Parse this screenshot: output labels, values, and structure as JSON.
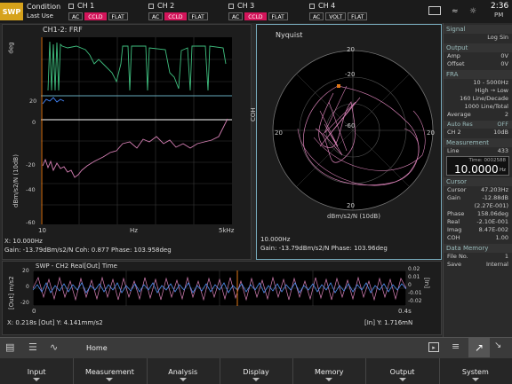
{
  "topbar": {
    "swp": "SWP",
    "condition": "Condition",
    "last_use": "Last Use",
    "channels": [
      {
        "name": "CH 1",
        "tags": [
          "AC",
          "CCLD",
          "FLAT"
        ],
        "active": [
          false,
          true,
          false
        ]
      },
      {
        "name": "CH 2",
        "tags": [
          "AC",
          "CCLD",
          "FLAT"
        ],
        "active": [
          false,
          true,
          false
        ]
      },
      {
        "name": "CH 3",
        "tags": [
          "AC",
          "CCLD",
          "FLAT"
        ],
        "active": [
          false,
          true,
          false
        ]
      },
      {
        "name": "CH 4",
        "tags": [
          "AC",
          "VOLT",
          "FLAT"
        ],
        "active": [
          false,
          false,
          false
        ]
      }
    ],
    "time": "2:36",
    "ampm": "PM"
  },
  "frf": {
    "title": "CH1-2: FRF",
    "ylabel_top": "deg",
    "ylabel_bottom": "dBm/s2/N (10dB)",
    "yticks": [
      "20",
      "0",
      "-20",
      "-40",
      "-60"
    ],
    "xticks": [
      "10",
      "Hz",
      "5kHz"
    ],
    "cursor_x": "X: 10.000Hz",
    "readout": "Gain: -13.79dBm/s2/N Coh: 0.877 Phase: 103.958deg"
  },
  "nyquist": {
    "title": "Nyquist",
    "ylabel": "COH",
    "rings": [
      "20",
      "-20",
      "-60"
    ],
    "sides": [
      "20",
      "20"
    ],
    "bottom": "20",
    "xlabel": "dBm/s2/N (10dB)",
    "cursor": "10.000Hz",
    "readout": "Gain: -13.79dBm/s2/N  Phase: 103.96deg"
  },
  "time": {
    "title": "SWP - CH2 Real[Out] Time",
    "ylabel_left": "[Out] m/s2",
    "ylabel_right": "[In]",
    "left_ticks": [
      "20",
      "0",
      "-20"
    ],
    "right_ticks": [
      "0.02",
      "0.01",
      "0",
      "-0.01",
      "-0.02"
    ],
    "xticks": [
      "0",
      "0.4s"
    ],
    "readout_left": "X: 0.218s [Out] Y: 4.141mm/s2",
    "readout_right": "[In] Y: 1.716mN"
  },
  "side": {
    "signal_h": "Signal",
    "signal": "Log Sin",
    "output_h": "Output",
    "amp_l": "Amp",
    "amp": "0V",
    "offset_l": "Offset",
    "offset": "0V",
    "fra_h": "FRA",
    "fra1": "10 -   5000Hz",
    "fra2": "High → Low",
    "fra3": "160 Line/Decade",
    "fra4": "1000 Line/Total",
    "avg_l": "Average",
    "avg": "2",
    "autores_h": "Auto Res",
    "autores": "OFF",
    "autores_ch": "CH 2",
    "autores_db": "10dB",
    "meas_h": "Measurement",
    "line_l": "Line",
    "line": "433",
    "time_l": "Time: 0002588",
    "big": "10.0000",
    "big_unit": "Hz",
    "cursor_h": "Cursor",
    "cursor_rows": [
      [
        "Cursor",
        "47.203Hz"
      ],
      [
        "Gain",
        "-12.88dB"
      ],
      [
        "",
        "(2.27E-001)"
      ],
      [
        "Phase",
        "158.06deg"
      ],
      [
        "Real",
        "-2.10E-001"
      ],
      [
        "Imag",
        "8.47E-002"
      ],
      [
        "COH",
        "1.00"
      ]
    ],
    "dm_h": "Data Memory",
    "file_l": "File No.",
    "file": "1",
    "save_l": "Save",
    "save": "Internal"
  },
  "toolbar": {
    "home": "Home"
  },
  "menu": [
    "Input",
    "Measurement",
    "Analysis",
    "Display",
    "Memory",
    "Output",
    "System"
  ]
}
